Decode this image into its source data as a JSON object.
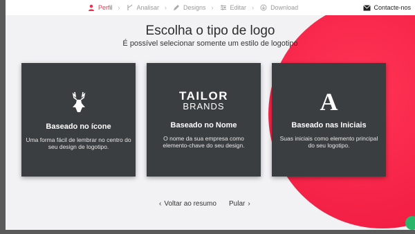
{
  "steps": [
    {
      "label": "Perfil",
      "icon": "person-icon",
      "active": true
    },
    {
      "label": "Analisar",
      "icon": "analyze-icon",
      "active": false
    },
    {
      "label": "Designs",
      "icon": "pencil-icon",
      "active": false
    },
    {
      "label": "Editar",
      "icon": "sliders-icon",
      "active": false
    },
    {
      "label": "Download",
      "icon": "download-icon",
      "active": false
    }
  ],
  "contact": {
    "label": "Contacte-nos",
    "icon": "envelope-icon"
  },
  "heading": "Escolha o tipo de logo",
  "subheading": "É possível selecionar somente um estilo de logotipo",
  "cards": [
    {
      "title": "Baseado no ícone",
      "description": "Uma forma fácil de lembrar no centro do seu design de logotipo.",
      "icon": "deer-icon"
    },
    {
      "title": "Baseado no Nome",
      "description": "O nome da sua empresa como elemento-chave do seu design.",
      "wordmark_line1": "TAILOR",
      "wordmark_line2": "BRANDS"
    },
    {
      "title": "Baseado nas Iniciais",
      "description": "Suas iniciais como elemento principal do seu logotipo.",
      "initial": "A"
    }
  ],
  "nav": {
    "back": "Voltar ao resumo",
    "skip": "Pular"
  },
  "colors": {
    "accent": "#f0304f",
    "card_bg": "#3a3e41",
    "page_bg": "#f2f2f4",
    "chat_green": "#2ab56b"
  }
}
